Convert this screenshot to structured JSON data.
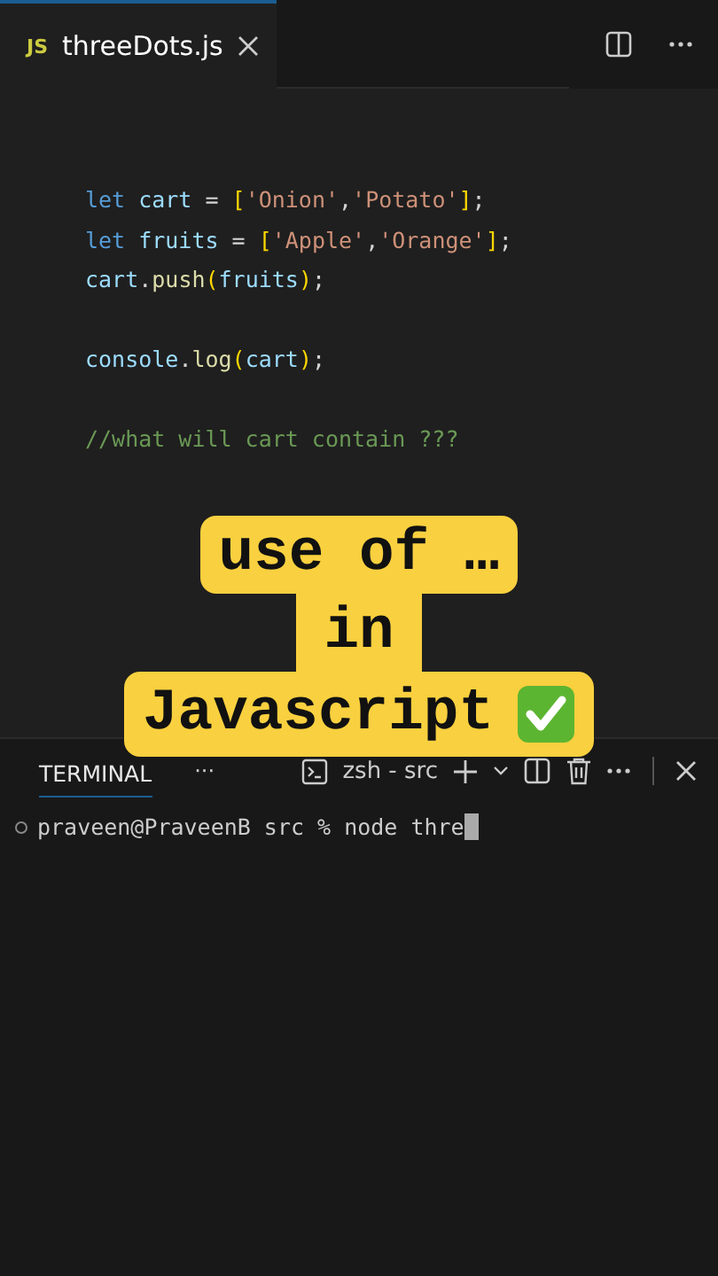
{
  "editor_tabs": [
    {
      "icon_label": "JS",
      "label": "threeDots.js",
      "selected": true
    }
  ],
  "code_lines": [
    {
      "kind": "code",
      "tokens": [
        {
          "text": "let",
          "kind": "keyword"
        },
        {
          "text": " cart",
          "kind": "variable"
        },
        {
          "text": " = ",
          "kind": "plain"
        },
        {
          "text": "[",
          "kind": "bracket"
        },
        {
          "text": "'Onion'",
          "kind": "string"
        },
        {
          "text": ",",
          "kind": "plain"
        },
        {
          "text": "'Potato'",
          "kind": "string"
        },
        {
          "text": "]",
          "kind": "bracket"
        },
        {
          "text": ";",
          "kind": "plain"
        }
      ]
    },
    {
      "kind": "code",
      "tokens": [
        {
          "text": "let",
          "kind": "keyword"
        },
        {
          "text": " fruits",
          "kind": "variable"
        },
        {
          "text": " = ",
          "kind": "plain"
        },
        {
          "text": "[",
          "kind": "bracket"
        },
        {
          "text": "'Apple'",
          "kind": "string"
        },
        {
          "text": ",",
          "kind": "plain"
        },
        {
          "text": "'Orange'",
          "kind": "string"
        },
        {
          "text": "]",
          "kind": "bracket"
        },
        {
          "text": ";",
          "kind": "plain"
        }
      ]
    },
    {
      "kind": "code",
      "tokens": [
        {
          "text": "cart",
          "kind": "variable"
        },
        {
          "text": ".",
          "kind": "plain"
        },
        {
          "text": "push",
          "kind": "function"
        },
        {
          "text": "(",
          "kind": "bracket"
        },
        {
          "text": "fruits",
          "kind": "variable"
        },
        {
          "text": ")",
          "kind": "bracket"
        },
        {
          "text": ";",
          "kind": "plain"
        }
      ]
    },
    {
      "kind": "blank"
    },
    {
      "kind": "code",
      "tokens": [
        {
          "text": "console",
          "kind": "variable"
        },
        {
          "text": ".",
          "kind": "plain"
        },
        {
          "text": "log",
          "kind": "function"
        },
        {
          "text": "(",
          "kind": "bracket"
        },
        {
          "text": "cart",
          "kind": "variable"
        },
        {
          "text": ")",
          "kind": "bracket"
        },
        {
          "text": ";",
          "kind": "plain"
        }
      ]
    },
    {
      "kind": "blank"
    },
    {
      "kind": "code",
      "tokens": [
        {
          "text": "//what will cart contain ???",
          "kind": "comment"
        }
      ]
    }
  ],
  "caption": [
    "use of …",
    "in",
    "Javascript"
  ],
  "panel": {
    "tabs": [
      {
        "label": "TERMINAL",
        "selected": true
      }
    ],
    "more": "···",
    "terminal_name": "zsh - src",
    "prompt": "praveen@PraveenB src % node thre"
  }
}
